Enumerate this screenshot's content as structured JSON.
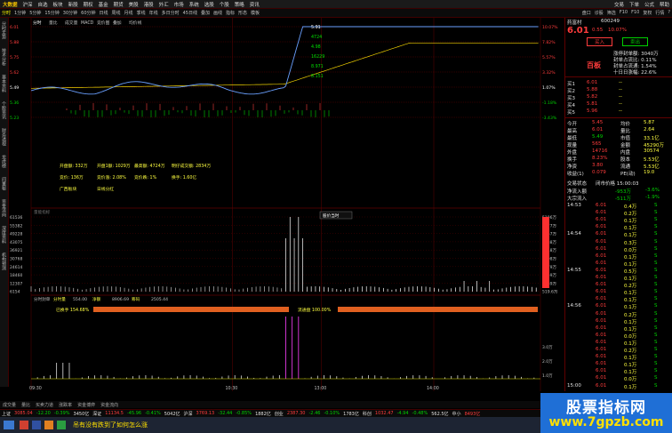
{
  "menubar": {
    "logo": "大数据",
    "items": [
      "沪深",
      "自选",
      "板块",
      "新股",
      "期权",
      "基金",
      "期货",
      "美股",
      "港股",
      "外汇",
      "市场",
      "系统",
      "选股",
      "个股",
      "策略",
      "资讯"
    ],
    "right": [
      "交易",
      "下单",
      "公式",
      "帮助"
    ]
  },
  "periodbar": {
    "items": [
      "分时",
      "1分钟",
      "5分钟",
      "15分钟",
      "30分钟",
      "60分钟",
      "日线",
      "周线",
      "月线",
      "季线",
      "年线",
      "多日分时",
      "45日线",
      "叠加",
      "画线",
      "指标",
      "形态",
      "模板"
    ],
    "active_index": 0,
    "right": [
      "盘口",
      "诊股",
      "筛选",
      "F10",
      "F10",
      "复权",
      "行情",
      "?"
    ]
  },
  "leftnav": [
    "分时走势",
    "技术分析",
    "基本资料",
    "个股资讯",
    "财务透视",
    "龙虎榜",
    "问董秘",
    "资金流向",
    "深度资料",
    "机构预测"
  ],
  "chart": {
    "header": [
      "分时",
      "量比",
      "成交量",
      "MACD",
      "竞价图",
      "叠加",
      "均价线"
    ],
    "price_labels": [
      "6.01",
      "5.88",
      "5.75",
      "5.62",
      "5.49",
      "5.36",
      "5.23"
    ],
    "pct_labels": [
      "10.07%",
      "7.82%",
      "5.57%",
      "3.32%",
      "1.07%",
      "-1.18%",
      "-3.43%"
    ],
    "vol_labels": [
      "61536",
      "55382",
      "49228",
      "43075",
      "36921",
      "30768",
      "24614",
      "18460",
      "12307",
      "6154"
    ],
    "vol_right": [
      "5196万",
      "4677万",
      "4157万",
      "3638万",
      "3118万",
      "2598万",
      "2079万",
      "1559万",
      "1039万",
      "519.6万"
    ],
    "annotations": [
      "5.91",
      "4724",
      "4.98",
      "16229",
      "8.971",
      "8.151"
    ],
    "info_lines": [
      [
        "开盘额: 332万",
        "开盘1额: 1029万",
        "最高额: 4724万",
        "明仔成交额: 2834万"
      ],
      [
        "竞价: 136万",
        "竞价涨: 2.08%",
        "竞价跌: 1%",
        "换手: 1.60亿"
      ],
      [
        "广西板块",
        "日线分红"
      ]
    ],
    "vol_label": "量能指标",
    "vol_tag": "股价当时",
    "lower_header": [
      "分时封单",
      "分时量",
      "554.00",
      "净额",
      "8906.69",
      "筹码",
      "2505.44"
    ],
    "lower_bar1": "已换手 154.68%",
    "lower_bar2": "流通盘 100.00%",
    "lower_right": [
      "3.0万",
      "2.0万",
      "1.0万"
    ],
    "time_labels": [
      "09:30",
      "10:30",
      "13:00",
      "14:00"
    ],
    "colors": {
      "up": "#ff3c3c",
      "down": "#00d000",
      "price": "#ffffff",
      "avg": "#f0d000",
      "grid": "#600000"
    }
  },
  "quote": {
    "name": "药富村",
    "code": "600249",
    "price": "6.01",
    "change": "0.55",
    "pct": "10.07%",
    "buttons": [
      "买入",
      "卖出"
    ],
    "limit_label": "百板",
    "top_info": [
      "涨停封单额: 3040万",
      "封单占流比: 0.11%",
      "封单占流通: 1.54%",
      "十日日涨幅: 22.6%"
    ],
    "asks": [
      [
        "卖5",
        "",
        ""
      ],
      [
        "卖4",
        "",
        ""
      ],
      [
        "卖3",
        "",
        ""
      ],
      [
        "卖2",
        "",
        ""
      ],
      [
        "卖1",
        "",
        ""
      ]
    ],
    "bids": [
      [
        "买1",
        "6.01",
        "--"
      ],
      [
        "买2",
        "5.88",
        "--"
      ],
      [
        "买3",
        "5.82",
        "--"
      ],
      [
        "买4",
        "5.81",
        "--"
      ],
      [
        "买5",
        "5.96",
        "--"
      ]
    ],
    "stats": [
      [
        "今开",
        "5.45",
        "均价",
        "5.87"
      ],
      [
        "最高",
        "6.01",
        "量比",
        "2.64"
      ],
      [
        "最低",
        "5.49",
        "市值",
        "33.1亿"
      ],
      [
        "现量",
        "565",
        "金额",
        "45290万"
      ],
      [
        "外盘",
        "14716",
        "内盘",
        "30574"
      ],
      [
        "换手",
        "8.23%",
        "股本",
        "5.53亿"
      ],
      [
        "净资",
        "3.80",
        "流通",
        "5.53亿"
      ],
      [
        "收益(1)",
        "0.079",
        "PE(动)",
        "19.0"
      ]
    ],
    "trade_status_label": "交易状态",
    "trade_status": "闭市价格 15:00:03",
    "flows": [
      [
        "净流入额",
        "-953万",
        "-3.6%"
      ],
      [
        "大宗流入",
        "-511万",
        "-1.9%"
      ]
    ],
    "ticks": [
      [
        "14:53",
        "6.01",
        "0.4万",
        "S"
      ],
      [
        "",
        "6.01",
        "0.2万",
        "S"
      ],
      [
        "",
        "6.01",
        "0.1万",
        "S"
      ],
      [
        "",
        "6.01",
        "0.1万",
        "S"
      ],
      [
        "14:54",
        "6.01",
        "0.1万",
        "S"
      ],
      [
        "",
        "6.01",
        "0.3万",
        "S"
      ],
      [
        "",
        "6.01",
        "0.0万",
        "S"
      ],
      [
        "",
        "6.01",
        "0.1万",
        "S"
      ],
      [
        "",
        "6.01",
        "0.1万",
        "S"
      ],
      [
        "14:55",
        "6.01",
        "0.5万",
        "S"
      ],
      [
        "",
        "6.01",
        "0.1万",
        "S"
      ],
      [
        "",
        "6.01",
        "0.2万",
        "S"
      ],
      [
        "",
        "6.01",
        "0.1万",
        "S"
      ],
      [
        "",
        "6.01",
        "0.1万",
        "S"
      ],
      [
        "14:56",
        "6.01",
        "0.1万",
        "S"
      ],
      [
        "",
        "6.01",
        "0.2万",
        "S"
      ],
      [
        "",
        "6.01",
        "0.1万",
        "S"
      ],
      [
        "",
        "6.01",
        "0.1万",
        "S"
      ],
      [
        "",
        "6.01",
        "0.0万",
        "S"
      ],
      [
        "",
        "6.01",
        "0.1万",
        "S"
      ],
      [
        "",
        "6.01",
        "0.2万",
        "S"
      ],
      [
        "",
        "6.01",
        "0.1万",
        "S"
      ],
      [
        "",
        "6.01",
        "0.1万",
        "S"
      ],
      [
        "",
        "6.01",
        "0.1万",
        "S"
      ],
      [
        "",
        "6.01",
        "0.0万",
        "S"
      ],
      [
        "15:00",
        "6.01",
        "0.1万",
        "S"
      ]
    ]
  },
  "tabs": [
    "成交量",
    "量比",
    "买卖力道",
    "涨跌率",
    "资金博弈",
    "资金流向"
  ],
  "statusbar": [
    [
      "上证",
      "3085.04",
      "-12.20",
      "-0.39%",
      "3450亿"
    ],
    [
      "深证",
      "11134.5",
      "-45.96",
      "-0.41%",
      "5042亿"
    ],
    [
      "沪深",
      "3769.13",
      "-32.44",
      "-0.85%",
      "1882亿"
    ],
    [
      "创业",
      "2387.30",
      "-2.46",
      "-0.10%",
      "1783亿"
    ],
    [
      "科创",
      "1032.47",
      "-4.94",
      "-0.48%",
      "562.5亿"
    ],
    [
      "中小",
      "8493亿"
    ]
  ],
  "taskbar_text": "吊有没有跌到了如何怎么涨",
  "watermark": {
    "line1": "股票指标网",
    "line2": "www.7gpzb.com"
  }
}
